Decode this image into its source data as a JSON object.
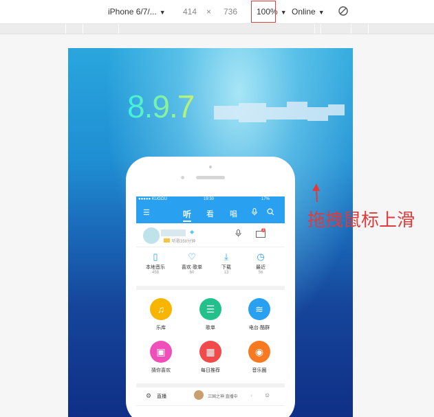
{
  "toolbar": {
    "device": "iPhone 6/7/...",
    "width": "414",
    "times": "×",
    "height": "736",
    "zoom": "100%",
    "network": "Online"
  },
  "splash": {
    "version": "8.9.7"
  },
  "app": {
    "status": {
      "carrier": "●●●●● KUGOU",
      "time": "19:30",
      "battery": "17%"
    },
    "nav": {
      "menu": "☰",
      "tabs": [
        "听",
        "看",
        "唱"
      ],
      "active_tab": "听"
    },
    "user": {
      "listen_time": "听歌358分钟"
    },
    "stats": [
      {
        "label": "本地音乐",
        "count": "458",
        "icon": "phone-icon"
      },
      {
        "label": "喜欢·歌单",
        "count": "60",
        "icon": "heart-icon"
      },
      {
        "label": "下载",
        "count": "13",
        "icon": "download-icon"
      },
      {
        "label": "最近",
        "count": "56",
        "icon": "clock-icon"
      }
    ],
    "grid": [
      {
        "label": "乐库",
        "icon": "music-note-icon",
        "color": "#f7b500"
      },
      {
        "label": "歌单",
        "icon": "playlist-icon",
        "color": "#22c08a"
      },
      {
        "label": "电台·酷群",
        "icon": "radio-wave-icon",
        "color": "#2aa1f0"
      },
      {
        "label": "猜你喜欢",
        "icon": "radio-icon",
        "color": "#ee4fb9"
      },
      {
        "label": "每日推荐",
        "icon": "calendar-icon",
        "color": "#f04a4a"
      },
      {
        "label": "音乐圈",
        "icon": "music-circle-icon",
        "color": "#f77a22"
      }
    ],
    "live": {
      "label": "直播",
      "subtitle": "三国之神 直播中"
    }
  },
  "annotation": "拖拽鼠标上滑"
}
